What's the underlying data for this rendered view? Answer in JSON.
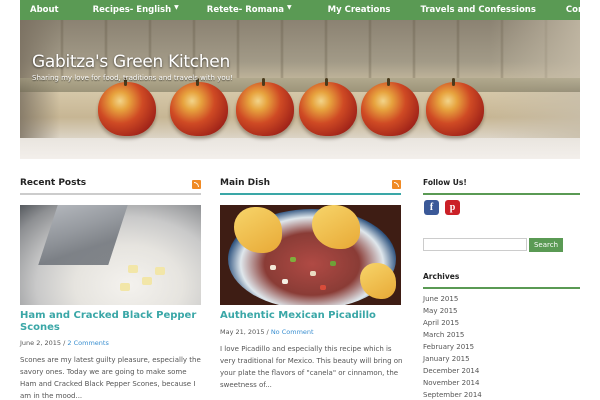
{
  "nav": {
    "items": [
      {
        "label": "About",
        "dropdown": false
      },
      {
        "label": "Recipes- English",
        "dropdown": true
      },
      {
        "label": "Retete- Romana",
        "dropdown": true
      },
      {
        "label": "My Creations",
        "dropdown": false
      },
      {
        "label": "Travels and Confessions",
        "dropdown": false
      },
      {
        "label": "Contact",
        "dropdown": false
      }
    ],
    "caret": "▼"
  },
  "header": {
    "title": "Gabitza's Green Kitchen",
    "tagline": "Sharing my love for food, traditions and travels with you!"
  },
  "recent_posts": {
    "heading": "Recent Posts",
    "post": {
      "title": "Ham and Cracked Black Pepper Scones",
      "date": "June 2, 2015",
      "separator": "/",
      "comments": "2 Comments",
      "excerpt": "Scones are my latest guilty pleasure, especially the savory ones. Today we are going to make some Ham and Cracked Black Pepper Scones, because I am in the mood..."
    }
  },
  "main_dish": {
    "heading": "Main Dish",
    "post": {
      "title": "Authentic Mexican Picadillo",
      "date": "May 21, 2015",
      "separator": "/",
      "comments": "No Comment",
      "excerpt": "I love Picadillo and especially this recipe which is very traditional for Mexico. This beauty will bring on your plate the flavors of \"canela\" or cinnamon, the sweetness of..."
    }
  },
  "sidebar": {
    "follow_heading": "Follow Us!",
    "social": [
      {
        "icon": "facebook-icon",
        "glyph": "f",
        "color": "#3b5998"
      },
      {
        "icon": "pinterest-icon",
        "glyph": "p",
        "color": "#cb2027"
      }
    ],
    "search": {
      "placeholder": "",
      "button": "Search"
    },
    "archives_heading": "Archives",
    "archives": [
      "June 2015",
      "May 2015",
      "April 2015",
      "March 2015",
      "February 2015",
      "January 2015",
      "December 2014",
      "November 2014",
      "September 2014"
    ]
  },
  "colors": {
    "nav": "#5a9a54",
    "accent_teal": "#3aa7a7",
    "rule_gray": "#cccccc",
    "rule_teal": "#3aa7a7",
    "rule_green": "#5a9a54",
    "link_blue": "#3a8fd0",
    "rss": "#f08a24"
  }
}
